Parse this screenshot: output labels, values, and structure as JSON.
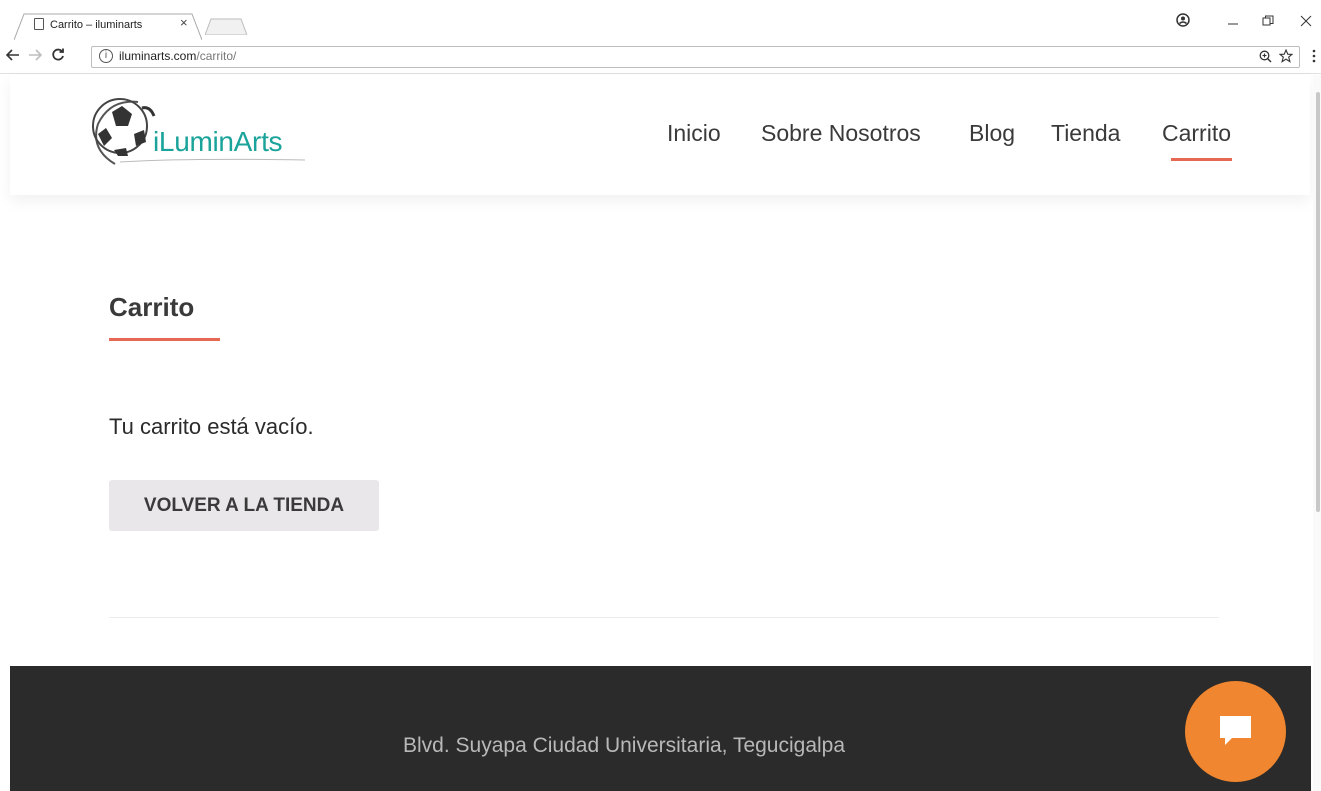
{
  "browser": {
    "tab_title": "Carrito – iluminarts",
    "tab_close": "×",
    "url_host": "iluminarts.com",
    "url_path": "/carrito/",
    "info_icon": "i",
    "icons": [
      "back-arrow-icon",
      "forward-arrow-icon",
      "reload-icon",
      "zoom-icon",
      "star-icon",
      "menu-icon",
      "account-icon",
      "minimize-icon",
      "restore-icon",
      "close-icon"
    ]
  },
  "site": {
    "logo_text": "iLuminArts",
    "nav": [
      {
        "label": "Inicio"
      },
      {
        "label": "Sobre Nosotros"
      },
      {
        "label": "Blog"
      },
      {
        "label": "Tienda"
      },
      {
        "label": "Carrito",
        "active": true
      }
    ],
    "accent_color": "#e66853",
    "logo_color": "#1aa39a"
  },
  "main": {
    "title": "Carrito",
    "empty_message": "Tu carrito está vacío.",
    "return_button": "VOLVER A LA TIENDA"
  },
  "footer": {
    "address": "Blvd. Suyapa Ciudad Universitaria, Tegucigalpa",
    "chat_color": "#f0862f"
  }
}
